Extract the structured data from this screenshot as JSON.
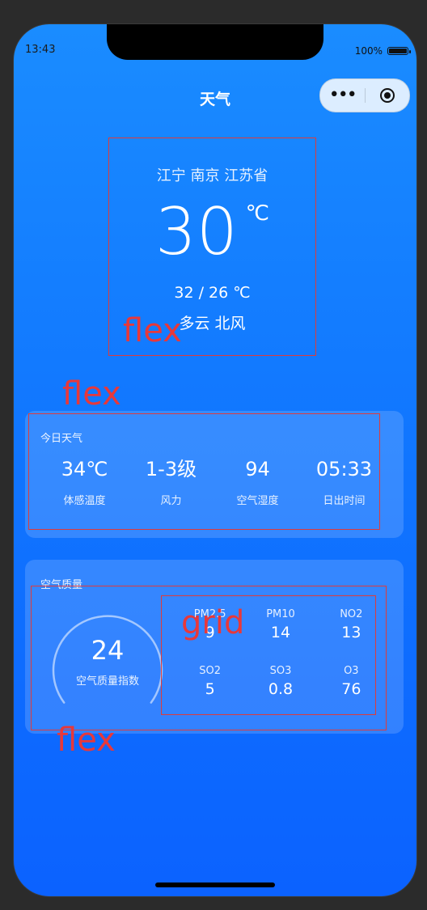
{
  "status_bar": {
    "time": "13:43",
    "battery": "100%",
    "battery_level": 1.0
  },
  "nav": {
    "title": "天气",
    "more_icon": "more-dots-icon",
    "close_icon": "target-icon"
  },
  "hero": {
    "location": "江宁 南京 江苏省",
    "temperature": "30",
    "unit": "℃",
    "range": "32 / 26 ℃",
    "description": "多云 北风"
  },
  "today": {
    "title": "今日天气",
    "items": [
      {
        "value": "34℃",
        "label": "体感温度"
      },
      {
        "value": "1-3级",
        "label": "风力"
      },
      {
        "value": "94",
        "label": "空气湿度"
      },
      {
        "value": "05:33",
        "label": "日出时间"
      }
    ]
  },
  "air": {
    "title": "空气质量",
    "aqi_value": "24",
    "aqi_label": "空气质量指数",
    "pollutants": [
      {
        "name": "PM2.5",
        "value": "9"
      },
      {
        "name": "PM10",
        "value": "14"
      },
      {
        "name": "NO2",
        "value": "13"
      },
      {
        "name": "SO2",
        "value": "5"
      },
      {
        "name": "SO3",
        "value": "0.8"
      },
      {
        "name": "O3",
        "value": "76"
      }
    ]
  },
  "annotations": {
    "flex_1": "flex",
    "flex_2": "flex",
    "grid": "grid",
    "flex_3": "flex"
  },
  "colors": {
    "accent": "#1177ff",
    "annotation": "#e8383a"
  }
}
